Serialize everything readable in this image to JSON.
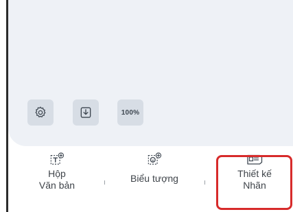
{
  "toolbar": {
    "settings_icon": "gear-icon",
    "export_icon": "download-icon",
    "zoom_label": "100%"
  },
  "bottom_bar": {
    "items": [
      {
        "icon": "text-box-add-icon",
        "label_line1": "Hộp",
        "label_line2": "Văn bản"
      },
      {
        "icon": "emoji-add-icon",
        "label_line1": "Biểu tượng"
      },
      {
        "icon": "label-design-icon",
        "label_line1": "Thiết kế",
        "label_line2": "Nhãn",
        "highlighted": true
      }
    ]
  },
  "colors": {
    "canvas": "#eef1f6",
    "button": "#d7dde5",
    "highlight": "#d72a2a"
  }
}
